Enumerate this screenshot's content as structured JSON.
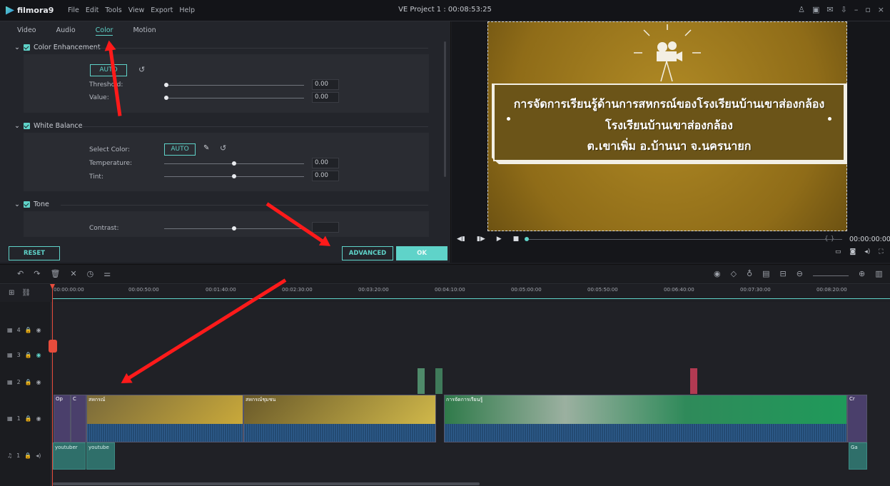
{
  "app": {
    "name": "filmora9",
    "project_title": "VE Project 1 : 00:08:53:25"
  },
  "menu": [
    "File",
    "Edit",
    "Tools",
    "View",
    "Export",
    "Help"
  ],
  "window_controls": [
    "user-icon",
    "save-icon",
    "mail-icon",
    "download-icon",
    "minimize-icon",
    "maximize-icon",
    "close-icon"
  ],
  "tabs": [
    "Video",
    "Audio",
    "Color",
    "Motion"
  ],
  "active_tab": "Color",
  "color_enhancement": {
    "title": "Color Enhancement",
    "auto": "AUTO",
    "threshold_label": "Threshold:",
    "threshold_value": "0.00",
    "value_label": "Value:",
    "value_value": "0.00"
  },
  "white_balance": {
    "title": "White Balance",
    "select_color_label": "Select Color:",
    "auto": "AUTO",
    "temperature_label": "Temperature:",
    "temperature_value": "0.00",
    "tint_label": "Tint:",
    "tint_value": "0.00"
  },
  "tone": {
    "title": "Tone",
    "contrast_label": "Contrast:"
  },
  "buttons": {
    "reset": "RESET",
    "advanced": "ADVANCED",
    "ok": "OK"
  },
  "preview": {
    "line1": "การจัดการเรียนรู้ด้านการสหกรณ์ของโรงเรียนบ้านเขาส่องกล้อง",
    "line2": "โรงเรียนบ้านเขาส่องกล้อง",
    "line3": "ต.เขาเพิ่ม อ.บ้านนา จ.นครนายก",
    "time": "00:00:00:00",
    "brace": "{ }"
  },
  "ruler": [
    "00:00:00:00",
    "00:00:50:00",
    "00:01:40:00",
    "00:02:30:00",
    "00:03:20:00",
    "00:04:10:00",
    "00:05:00:00",
    "00:05:50:00",
    "00:06:40:00",
    "00:07:30:00",
    "00:08:20:00"
  ],
  "tracks": [
    "4",
    "3",
    "2",
    "1",
    "1"
  ],
  "clips": {
    "c1": "Op",
    "c2": "C",
    "c3": "สหกรณ์",
    "c4": "สหกรณ์ชุมชน",
    "c5": "การจัดการเรียนรู้",
    "c6": "Cr"
  },
  "audio": {
    "a1": "youtuber",
    "a2": "youtube",
    "a3": "Ga"
  }
}
